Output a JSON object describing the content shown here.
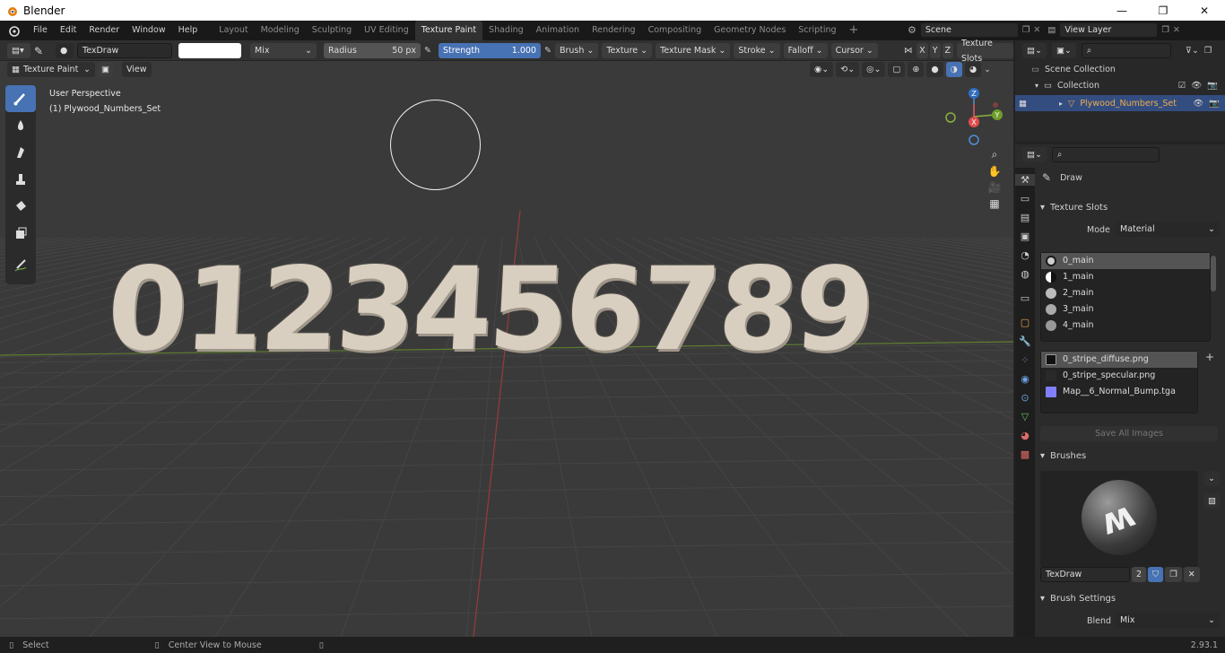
{
  "window": {
    "title": "Blender",
    "minimize": "—",
    "maximize": "❐",
    "close": "✕"
  },
  "menu": [
    "File",
    "Edit",
    "Render",
    "Window",
    "Help"
  ],
  "workspaces": [
    "Layout",
    "Modeling",
    "Sculpting",
    "UV Editing",
    "Texture Paint",
    "Shading",
    "Animation",
    "Rendering",
    "Compositing",
    "Geometry Nodes",
    "Scripting"
  ],
  "active_workspace": "Texture Paint",
  "scene": {
    "label": "Scene",
    "view_layer": "View Layer"
  },
  "tool_header": {
    "brush_name": "TexDraw",
    "blend": "Mix",
    "radius_label": "Radius",
    "radius_value": "50 px",
    "strength_label": "Strength",
    "strength_value": "1.000",
    "menus": [
      "Brush",
      "Texture",
      "Texture Mask",
      "Stroke",
      "Falloff",
      "Cursor"
    ],
    "axes": [
      "X",
      "Y",
      "Z"
    ],
    "texture_slots": "Texture Slots"
  },
  "mode_header": {
    "mode": "Texture Paint",
    "view": "View"
  },
  "viewport": {
    "perspective": "User Perspective",
    "object": "(1) Plywood_Numbers_Set",
    "digits": [
      "0",
      "1",
      "2",
      "3",
      "4",
      "5",
      "6",
      "7",
      "8",
      "9"
    ],
    "gizmo": {
      "x": "X",
      "y": "Y",
      "z": "Z"
    }
  },
  "outliner": {
    "scene_collection": "Scene Collection",
    "collection": "Collection",
    "object": "Plywood_Numbers_Set"
  },
  "properties": {
    "tool_name": "Draw",
    "texture_slots_title": "Texture Slots",
    "mode_label": "Mode",
    "mode_value": "Material",
    "materials": [
      "0_main",
      "1_main",
      "2_main",
      "3_main",
      "4_main"
    ],
    "images": [
      "0_stripe_diffuse.png",
      "0_stripe_specular.png",
      "Map__6_Normal_Bump.tga"
    ],
    "save_all": "Save All Images",
    "brushes_title": "Brushes",
    "brush_field": "TexDraw",
    "brush_users": "2",
    "brush_settings_title": "Brush Settings",
    "blend_label": "Blend",
    "blend_value": "Mix"
  },
  "status": {
    "select": "Select",
    "center": "Center View to Mouse",
    "version": "2.93.1"
  },
  "colors": {
    "accent": "#4772b3",
    "header": "#303030",
    "viewport": "#3a3a3a",
    "digit": "#d9cfc0"
  }
}
